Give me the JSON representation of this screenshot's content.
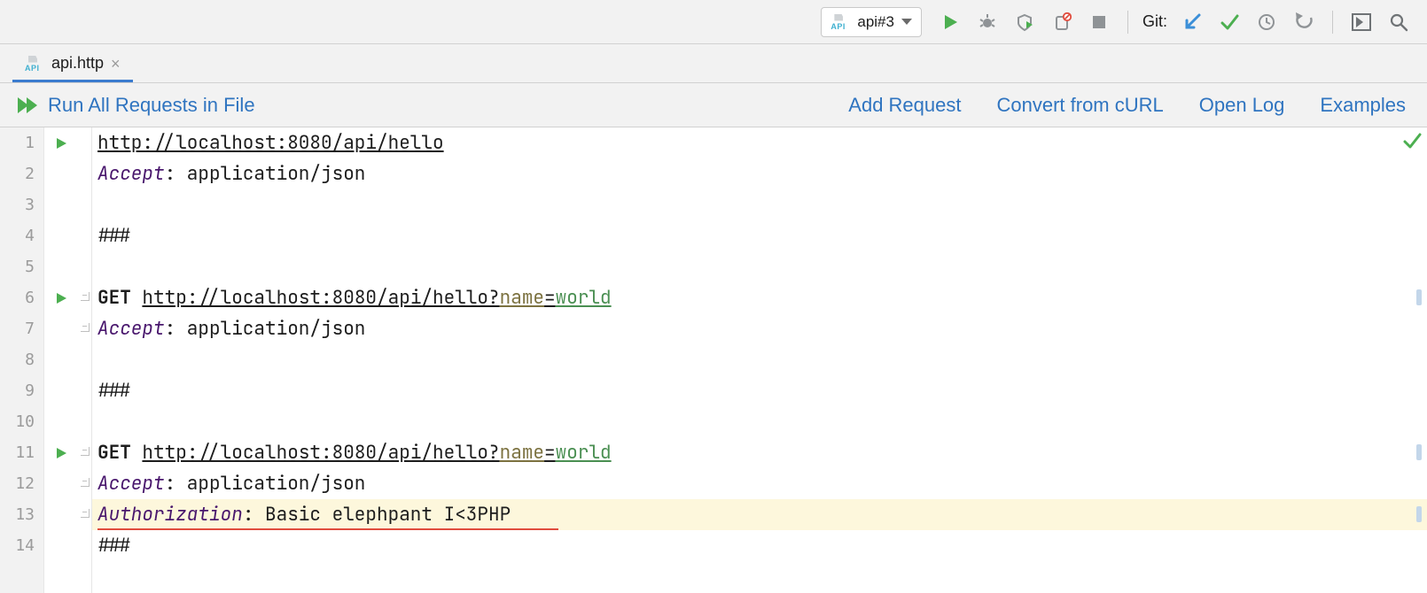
{
  "toolbar": {
    "run_config": "api#3",
    "git_label": "Git:"
  },
  "tab": {
    "filename": "api.http"
  },
  "httpbar": {
    "run_all": "Run All Requests in File",
    "add_request": "Add Request",
    "convert_curl": "Convert from cURL",
    "open_log": "Open Log",
    "examples": "Examples"
  },
  "code": {
    "lines": [
      {
        "n": 1,
        "run": true,
        "fold": false,
        "kind": "url",
        "url": "http://localhost:8080/api/hello"
      },
      {
        "n": 2,
        "run": false,
        "fold": false,
        "kind": "header",
        "name": "Accept",
        "value": "application/json"
      },
      {
        "n": 3,
        "run": false,
        "fold": false,
        "kind": "blank"
      },
      {
        "n": 4,
        "run": false,
        "fold": false,
        "kind": "sep",
        "text": "###"
      },
      {
        "n": 5,
        "run": false,
        "fold": false,
        "kind": "blank"
      },
      {
        "n": 6,
        "run": true,
        "fold": true,
        "kind": "geturl",
        "method": "GET",
        "url_base": "http://localhost:8080/api/hello?",
        "qname": "name",
        "eq": "=",
        "qval": "world",
        "hint": true
      },
      {
        "n": 7,
        "run": false,
        "fold": true,
        "kind": "header",
        "name": "Accept",
        "value": "application/json"
      },
      {
        "n": 8,
        "run": false,
        "fold": false,
        "kind": "blank"
      },
      {
        "n": 9,
        "run": false,
        "fold": false,
        "kind": "sep",
        "text": "###"
      },
      {
        "n": 10,
        "run": false,
        "fold": false,
        "kind": "blank"
      },
      {
        "n": 11,
        "run": true,
        "fold": true,
        "kind": "geturl",
        "method": "GET",
        "url_base": "http://localhost:8080/api/hello?",
        "qname": "name",
        "eq": "=",
        "qval": "world",
        "hint": true
      },
      {
        "n": 12,
        "run": false,
        "fold": true,
        "kind": "header",
        "name": "Accept",
        "value": "application/json"
      },
      {
        "n": 13,
        "run": false,
        "fold": true,
        "kind": "header",
        "name": "Authorization",
        "value": "Basic elephpant I<3PHP",
        "highlight": true,
        "error_underline": true,
        "hint": true
      },
      {
        "n": 14,
        "run": false,
        "fold": false,
        "kind": "sep",
        "text": "###"
      }
    ]
  },
  "icons": {
    "run": "run-icon",
    "debug": "debug-icon",
    "coverage": "coverage-icon",
    "profile": "profile-icon",
    "stop": "stop-icon",
    "git_pull": "git-pull-icon",
    "git_commit": "git-commit-icon",
    "git_history": "git-history-icon",
    "git_revert": "git-revert-icon",
    "terminal": "terminal-icon",
    "search": "search-icon",
    "status_ok": "check-icon"
  }
}
